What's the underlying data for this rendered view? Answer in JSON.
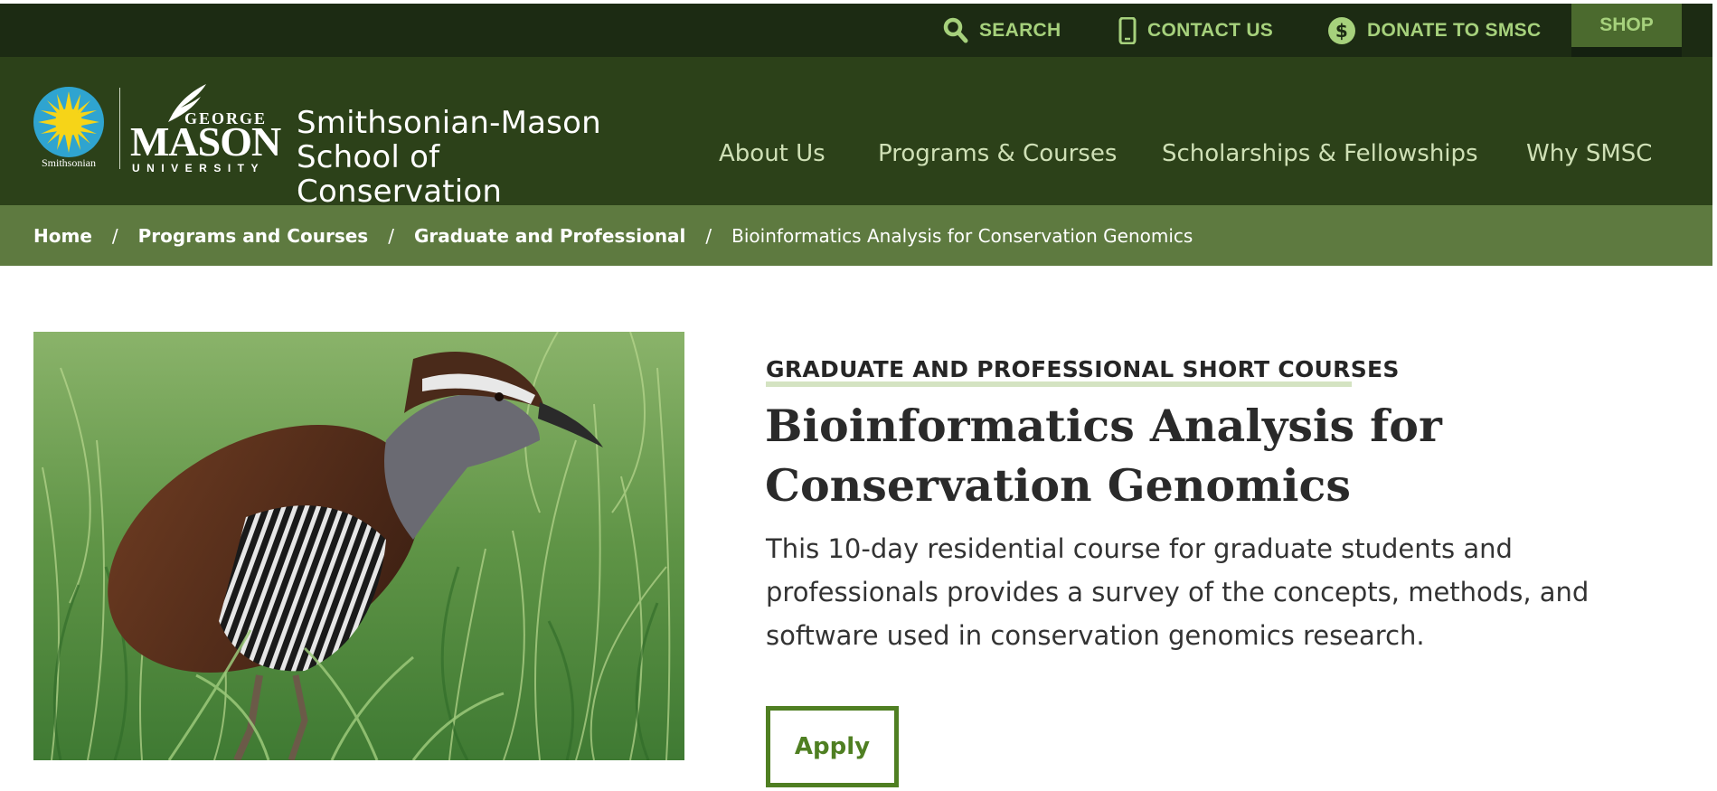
{
  "utility": {
    "search_label": "SEARCH",
    "contact_label": "CONTACT US",
    "donate_label": "DONATE TO SMSC",
    "shop_label": "SHOP"
  },
  "header": {
    "smithsonian_label": "Smithsonian",
    "gmu_george": "GEORGE",
    "gmu_mason": "MASON",
    "gmu_university": "UNIVERSITY",
    "site_name_line1": "Smithsonian-Mason",
    "site_name_line2": "School of Conservation",
    "nav": [
      "About Us",
      "Programs & Courses",
      "Scholarships & Fellowships",
      "Why SMSC"
    ]
  },
  "breadcrumb": {
    "items": [
      "Home",
      "Programs and Courses",
      "Graduate and Professional"
    ],
    "current": "Bioinformatics Analysis for Conservation Genomics",
    "separator": "/"
  },
  "course": {
    "eyebrow": "GRADUATE AND PROFESSIONAL SHORT COURSES",
    "title": "Bioinformatics Analysis for Conservation Genomics",
    "summary": "This 10-day residential course for graduate students and professionals provides a survey of the concepts, methods, and software used in conservation genomics research.",
    "apply_label": "Apply"
  },
  "colors": {
    "utility_bg": "#1c2b13",
    "header_bg": "#2c4119",
    "breadcrumb_bg": "#5e7a40",
    "accent_green": "#a6d17c",
    "button_green": "#4f7f22"
  },
  "icons": [
    "search-icon",
    "phone-icon",
    "dollar-circle-icon"
  ]
}
